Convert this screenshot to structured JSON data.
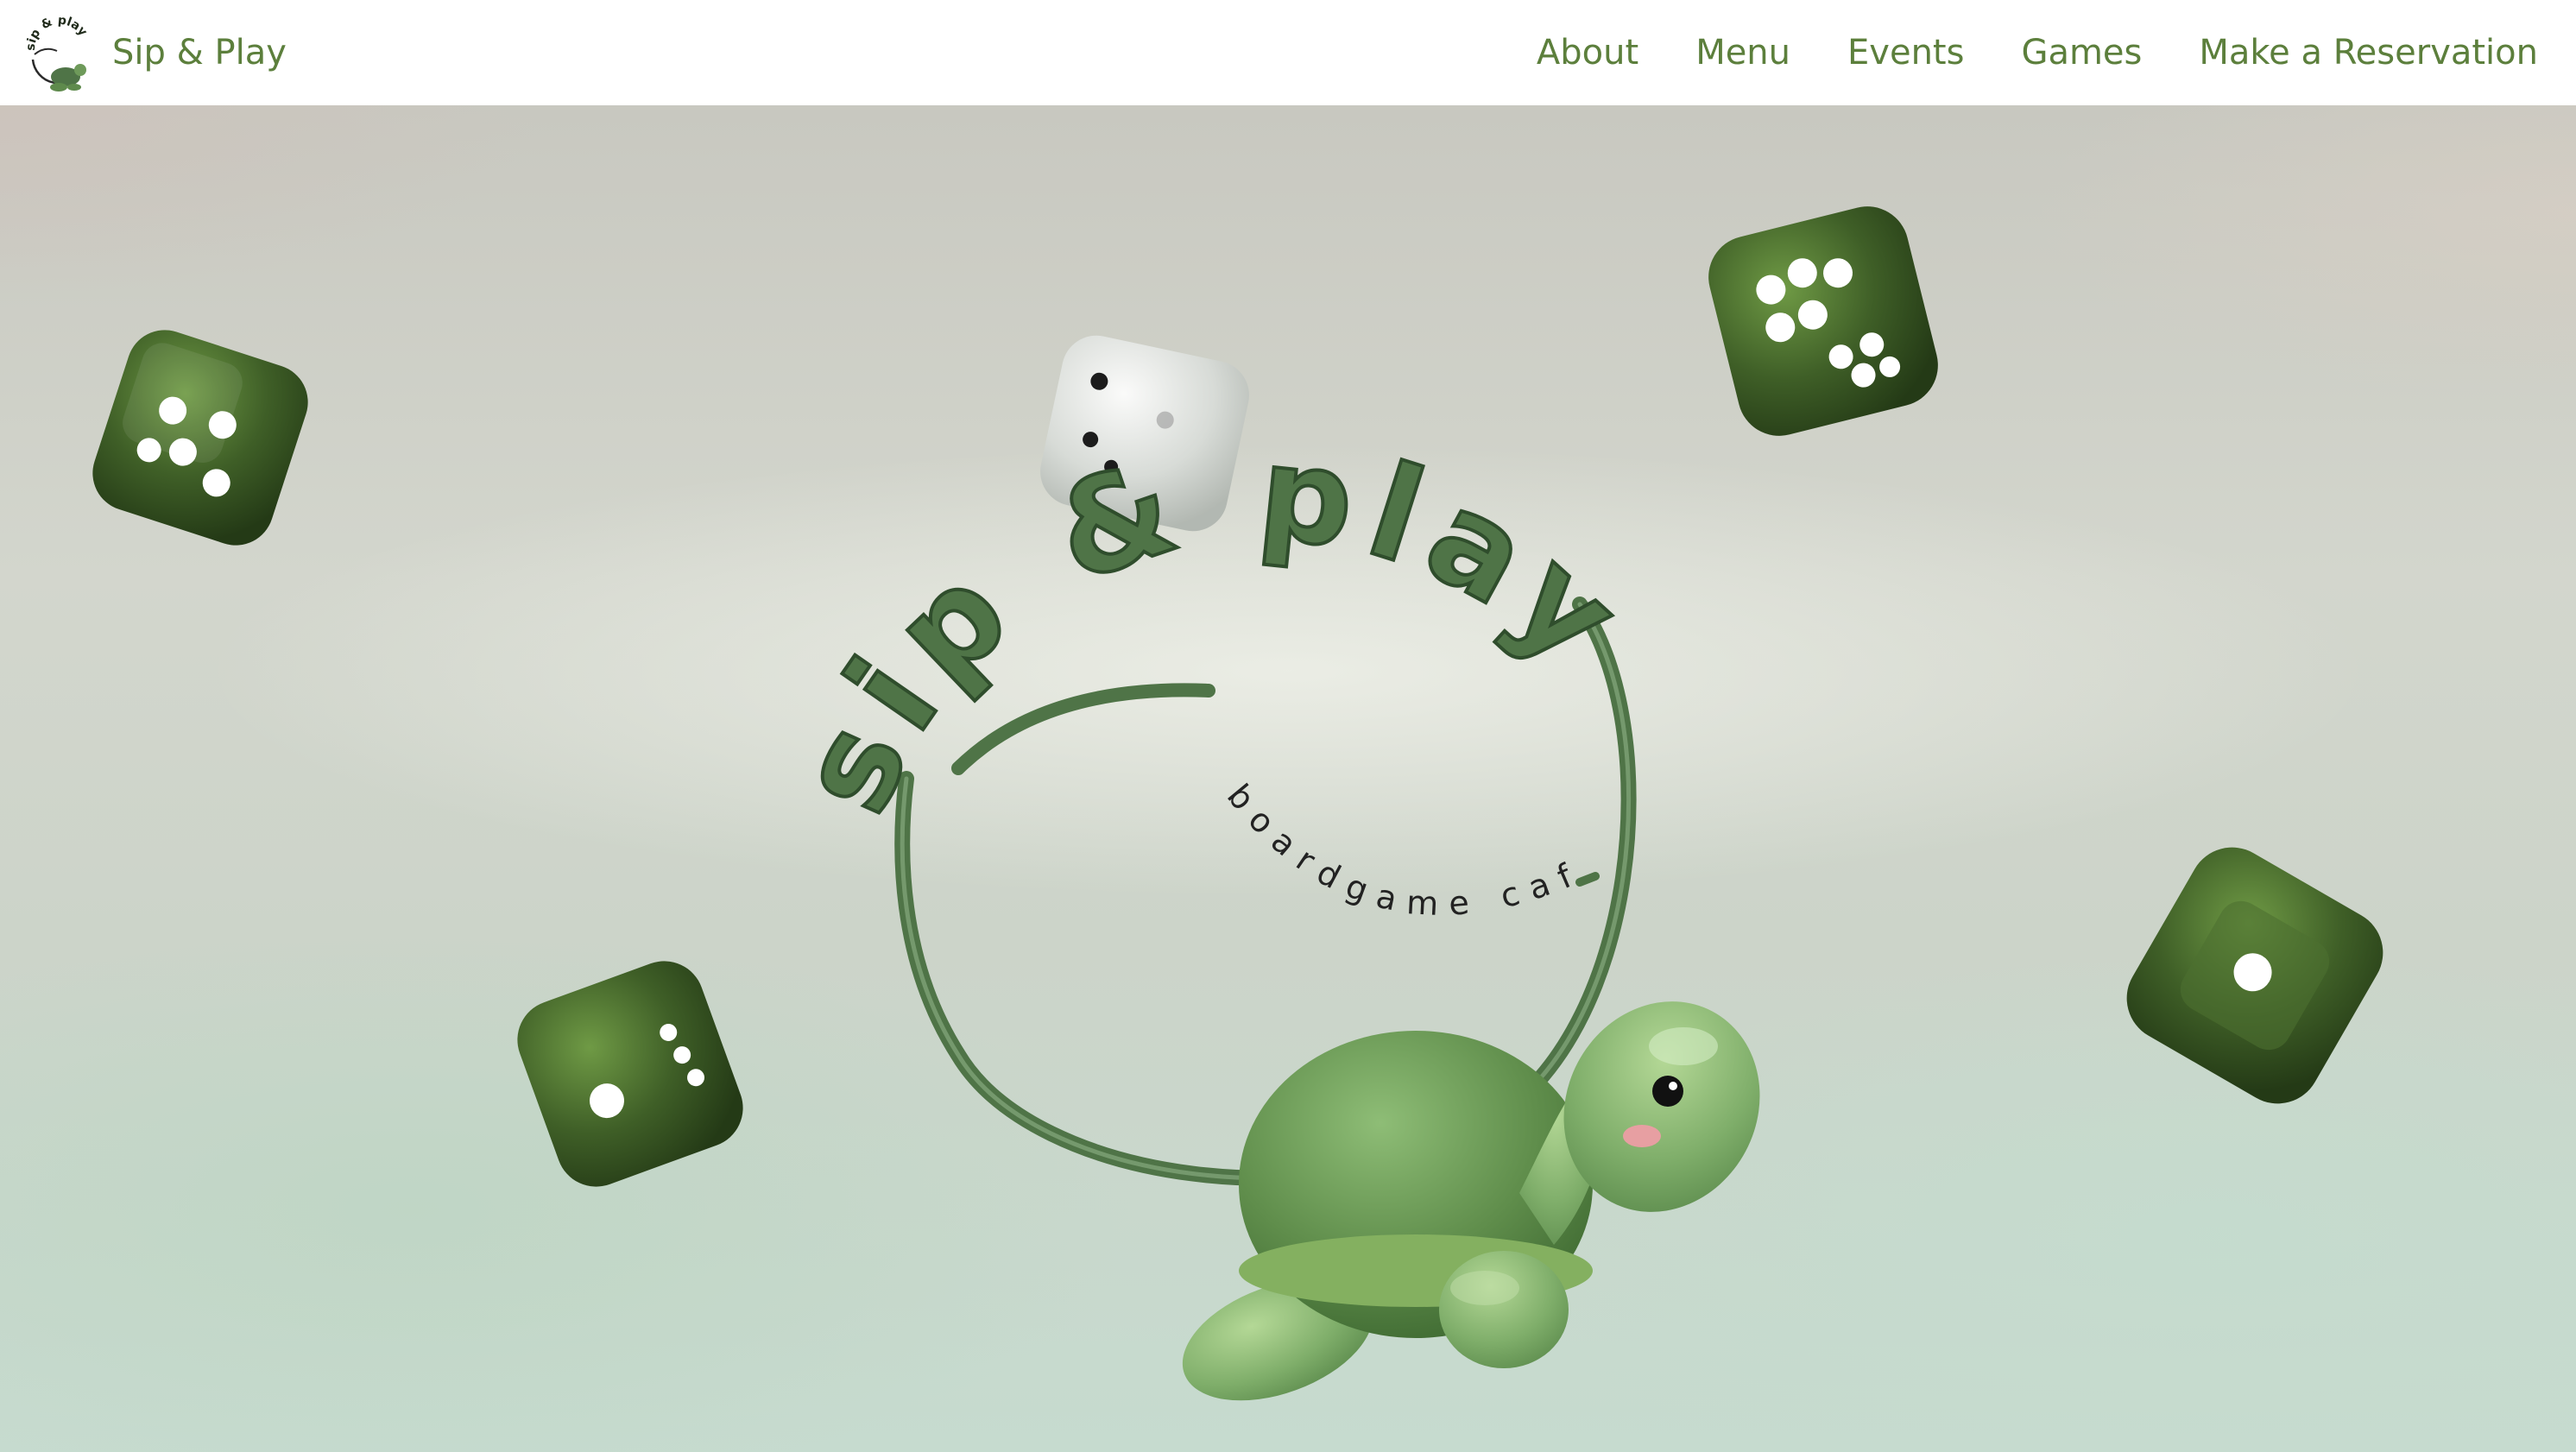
{
  "brand": {
    "name": "Sip & Play",
    "logo_text": "sip & play"
  },
  "nav": {
    "items": [
      {
        "label": "About"
      },
      {
        "label": "Menu"
      },
      {
        "label": "Events"
      },
      {
        "label": "Games"
      },
      {
        "label": "Make a Reservation"
      }
    ]
  },
  "hero": {
    "wordmark": "sip & play",
    "subtitle": "boardgame cafe",
    "mascot": "turtle",
    "dice_count": 5,
    "colors": {
      "accent": "#5c7f3c",
      "dice": "#3f5f27",
      "turtle": "#7fae6a",
      "ring": "#4f7447"
    }
  }
}
